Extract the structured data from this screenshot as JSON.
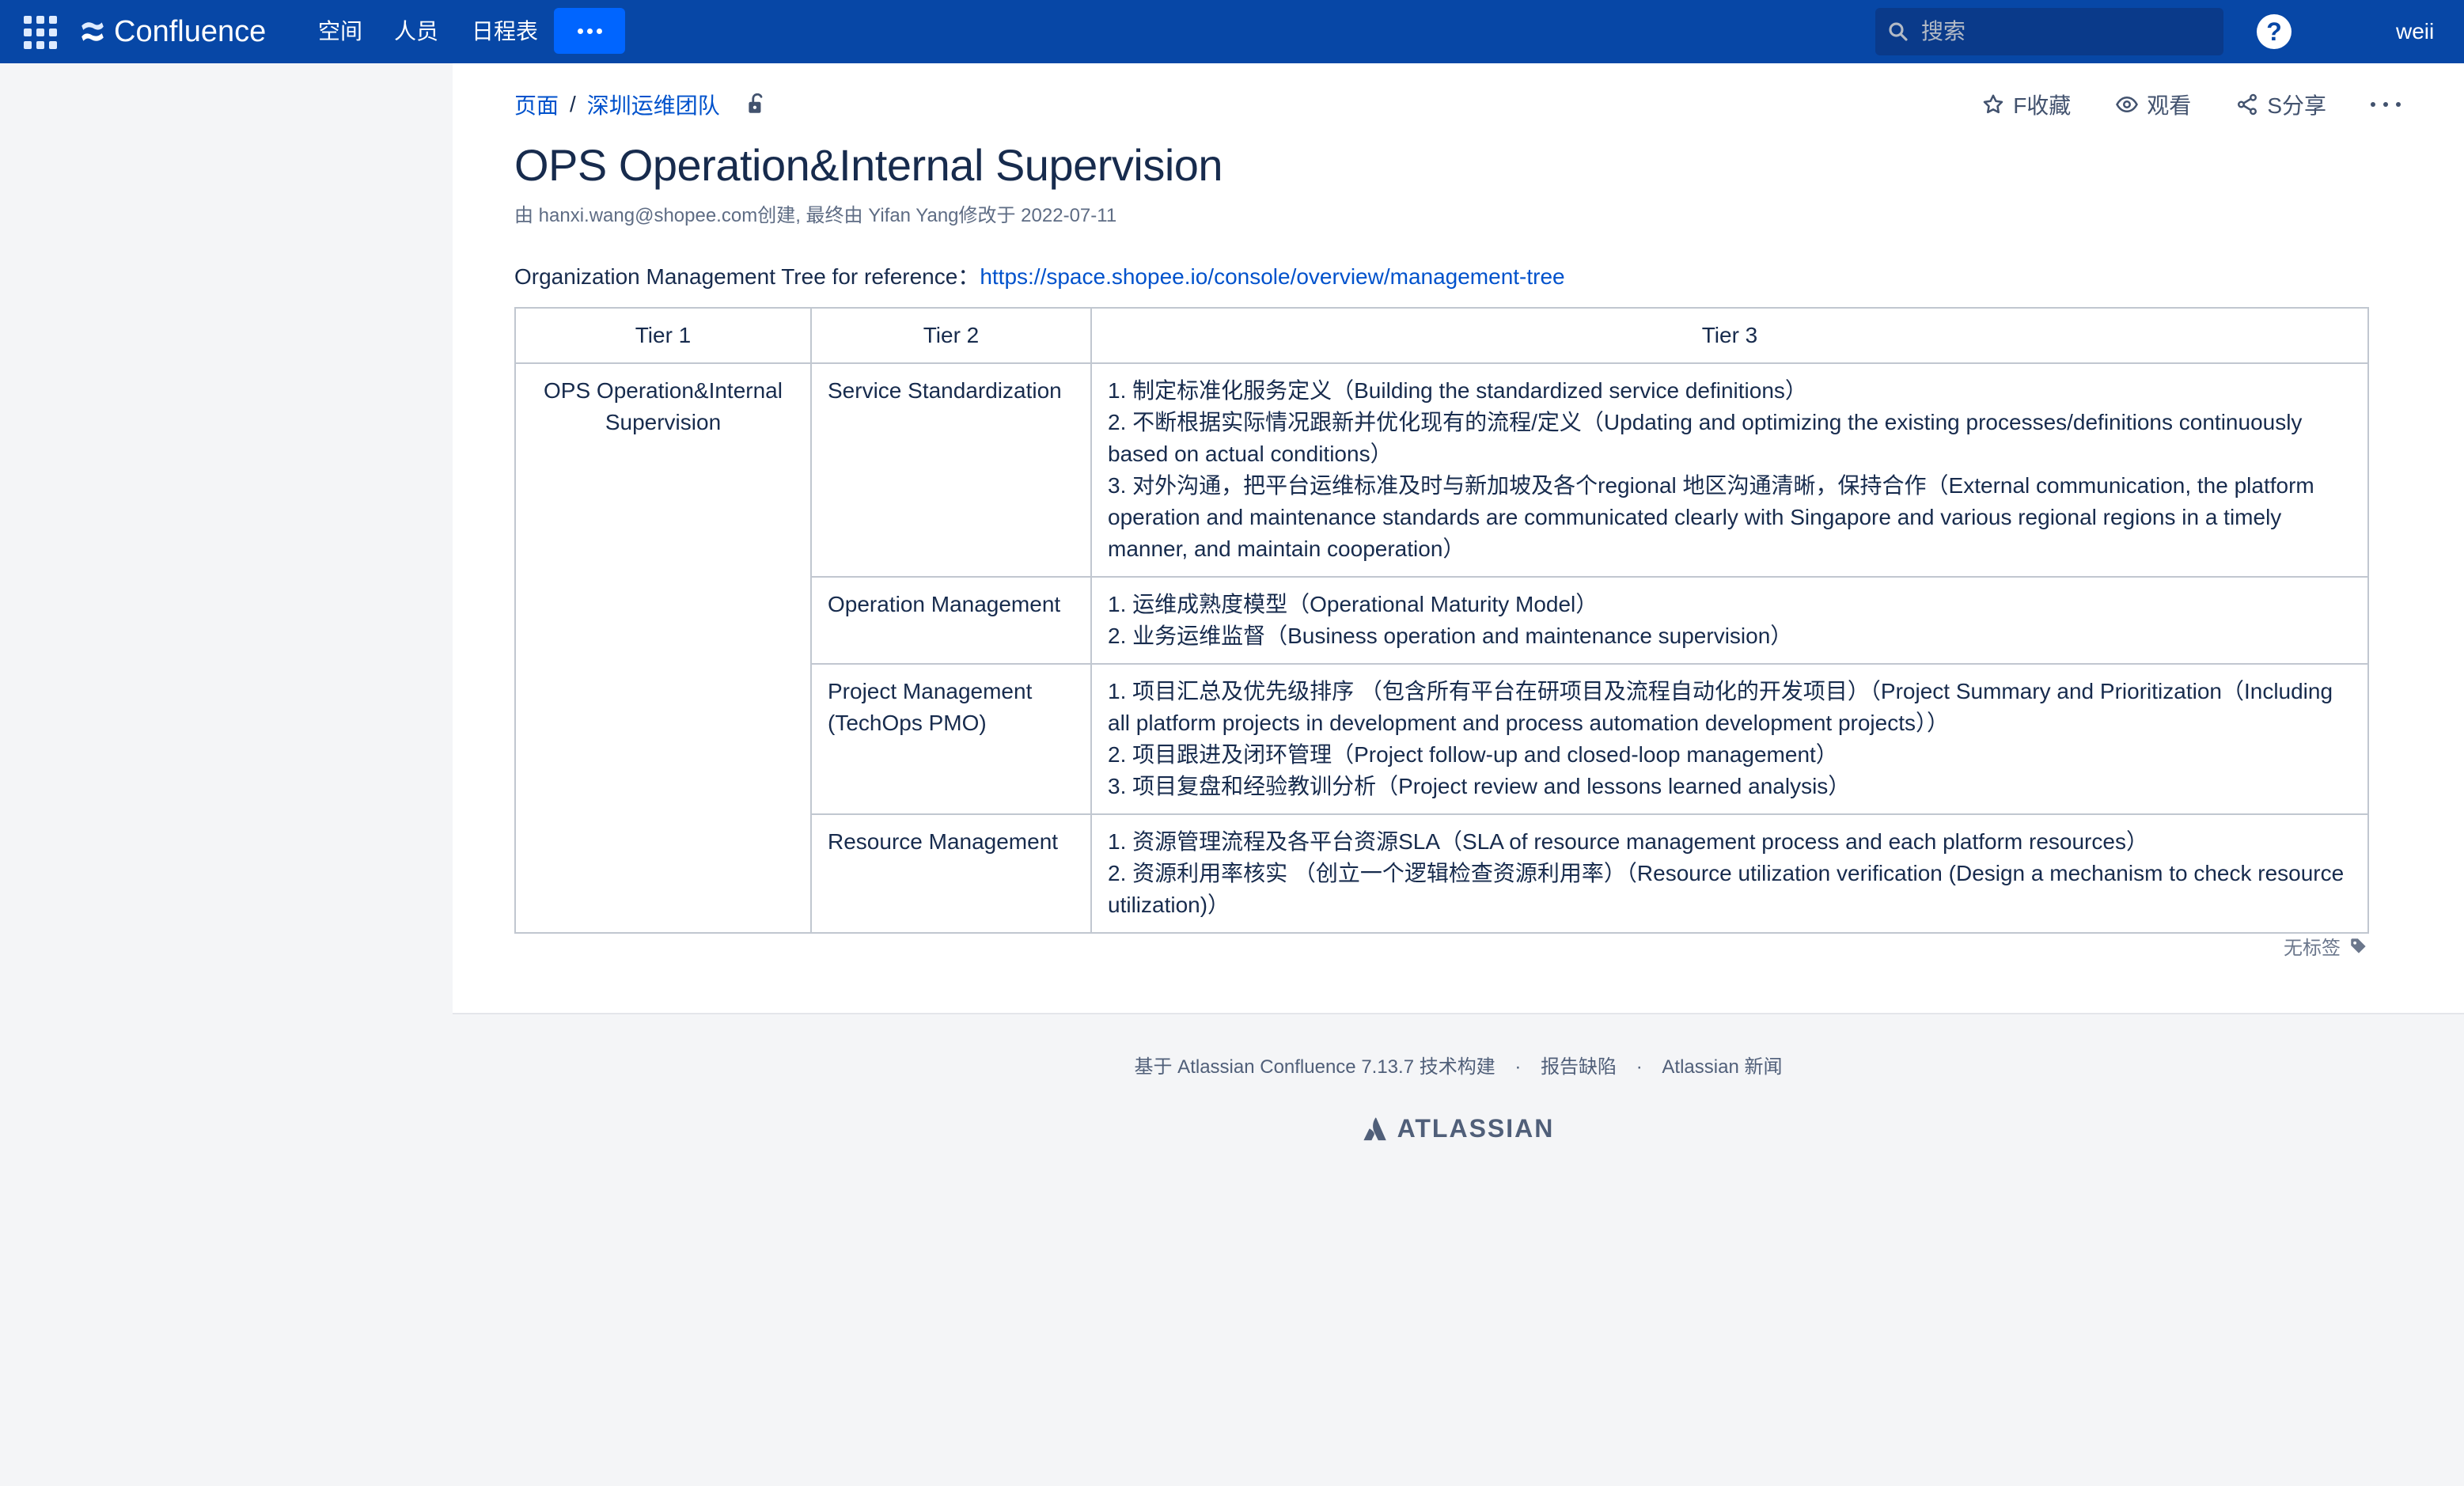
{
  "nav": {
    "logo_text": "Confluence",
    "links": [
      "空间",
      "人员",
      "日程表"
    ],
    "search_placeholder": "搜索",
    "help_label": "?",
    "user": "weii"
  },
  "breadcrumb": {
    "root": "页面",
    "space": "深圳运维团队"
  },
  "actions": {
    "save": "F收藏",
    "watch": "观看",
    "share": "S分享"
  },
  "page": {
    "title": "OPS Operation&Internal Supervision",
    "byline": "由 hanxi.wang@shopee.com创建, 最终由 Yifan Yang修改于 2022-07-11",
    "intro_text": "Organization Management Tree for reference：",
    "intro_link": "https://space.shopee.io/console/overview/management-tree"
  },
  "table": {
    "headers": [
      "Tier 1",
      "Tier 2",
      "Tier 3"
    ],
    "tier1": "OPS Operation&Internal Supervision",
    "rows": [
      {
        "tier2": "Service Standardization",
        "tier3": [
          "1. 制定标准化服务定义（Building the standardized service definitions）",
          "2. 不断根据实际情况跟新并优化现有的流程/定义（Updating and optimizing the existing processes/definitions continuously based on actual conditions）",
          "3. 对外沟通，把平台运维标准及时与新加坡及各个regional 地区沟通清晰，保持合作（External communication, the platform operation and maintenance standards are communicated clearly with Singapore and various regional regions in a timely manner, and maintain cooperation）"
        ]
      },
      {
        "tier2": "Operation Management",
        "tier3": [
          "1. 运维成熟度模型（Operational Maturity Model）",
          "2. 业务运维监督（Business operation and maintenance supervision）"
        ]
      },
      {
        "tier2": "Project Management (TechOps PMO)",
        "tier3": [
          "1. 项目汇总及优先级排序 （包含所有平台在研项目及流程自动化的开发项目）（Project Summary and Prioritization（Including all platform projects in development and process automation development projects））",
          "2. 项目跟进及闭环管理（Project follow-up and closed-loop management）",
          "3. 项目复盘和经验教训分析（Project review and lessons learned analysis）"
        ]
      },
      {
        "tier2": "Resource Management",
        "tier3": [
          "1. 资源管理流程及各平台资源SLA（SLA of resource management process and each platform resources）",
          "2. 资源利用率核实 （创立一个逻辑检查资源利用率）（Resource utilization verification (Design a mechanism to check resource utilization)）"
        ]
      }
    ]
  },
  "labels": {
    "no_labels": "无标签"
  },
  "footer": {
    "powered": "基于 Atlassian Confluence 7.13.7 技术构建",
    "report": "报告缺陷",
    "news": "Atlassian 新闻",
    "brand": "ATLASSIAN",
    "separator": "·"
  }
}
